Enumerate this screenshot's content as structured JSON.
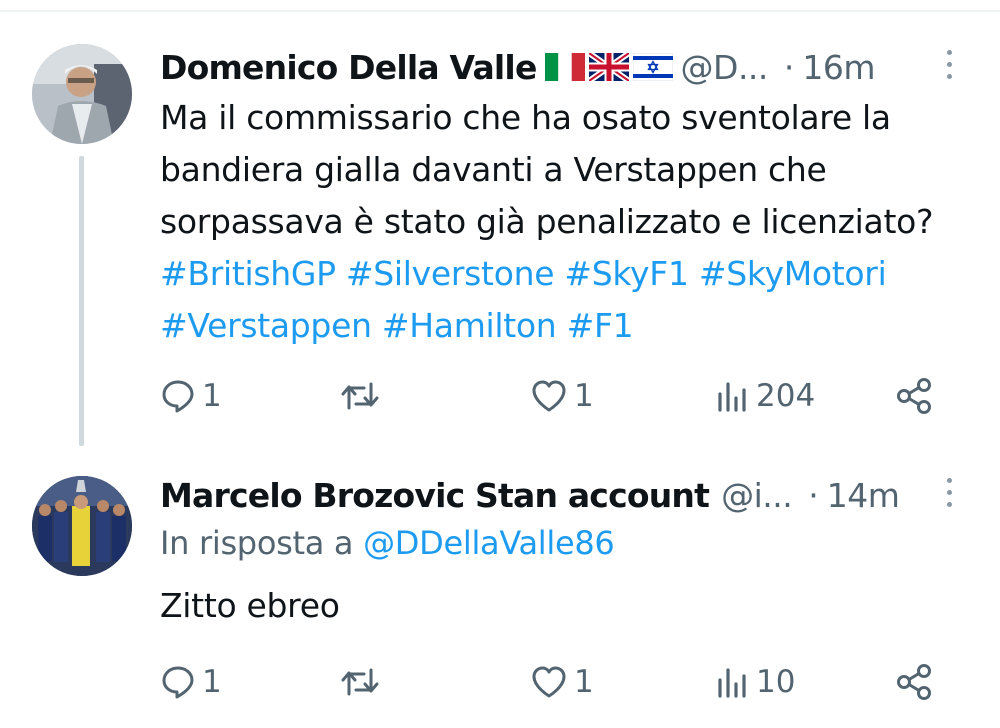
{
  "tweets": [
    {
      "name": "Domenico Della Valle",
      "flags": [
        "italy-flag-icon",
        "uk-flag-icon",
        "israel-flag-icon"
      ],
      "handle": "@D...",
      "separator": "·",
      "time": "16m",
      "text_plain": "Ma il commissario che ha osato sventolare la bandiera gialla davanti a Verstappen che sorpassava è stato già penalizzato e licenziato?",
      "hashtags": [
        "#BritishGP",
        "#Silverstone",
        "#SkyF1",
        "#SkyMotori",
        "#Verstappen",
        "#Hamilton",
        "#F1"
      ],
      "replies": "1",
      "retweets": "",
      "likes": "1",
      "views": "204"
    },
    {
      "name": "Marcelo Brozovic Stan account",
      "handle": "@i...",
      "separator": "·",
      "time": "14m",
      "reply_prefix": "In risposta a",
      "reply_mention": "@DDellaValle86",
      "text": "Zitto ebreo",
      "replies": "1",
      "retweets": "",
      "likes": "1",
      "views": "10"
    }
  ],
  "colors": {
    "link": "#1d9bf0",
    "secondary": "#536471",
    "text": "#0f1419",
    "thread_line": "#cfd9de"
  }
}
